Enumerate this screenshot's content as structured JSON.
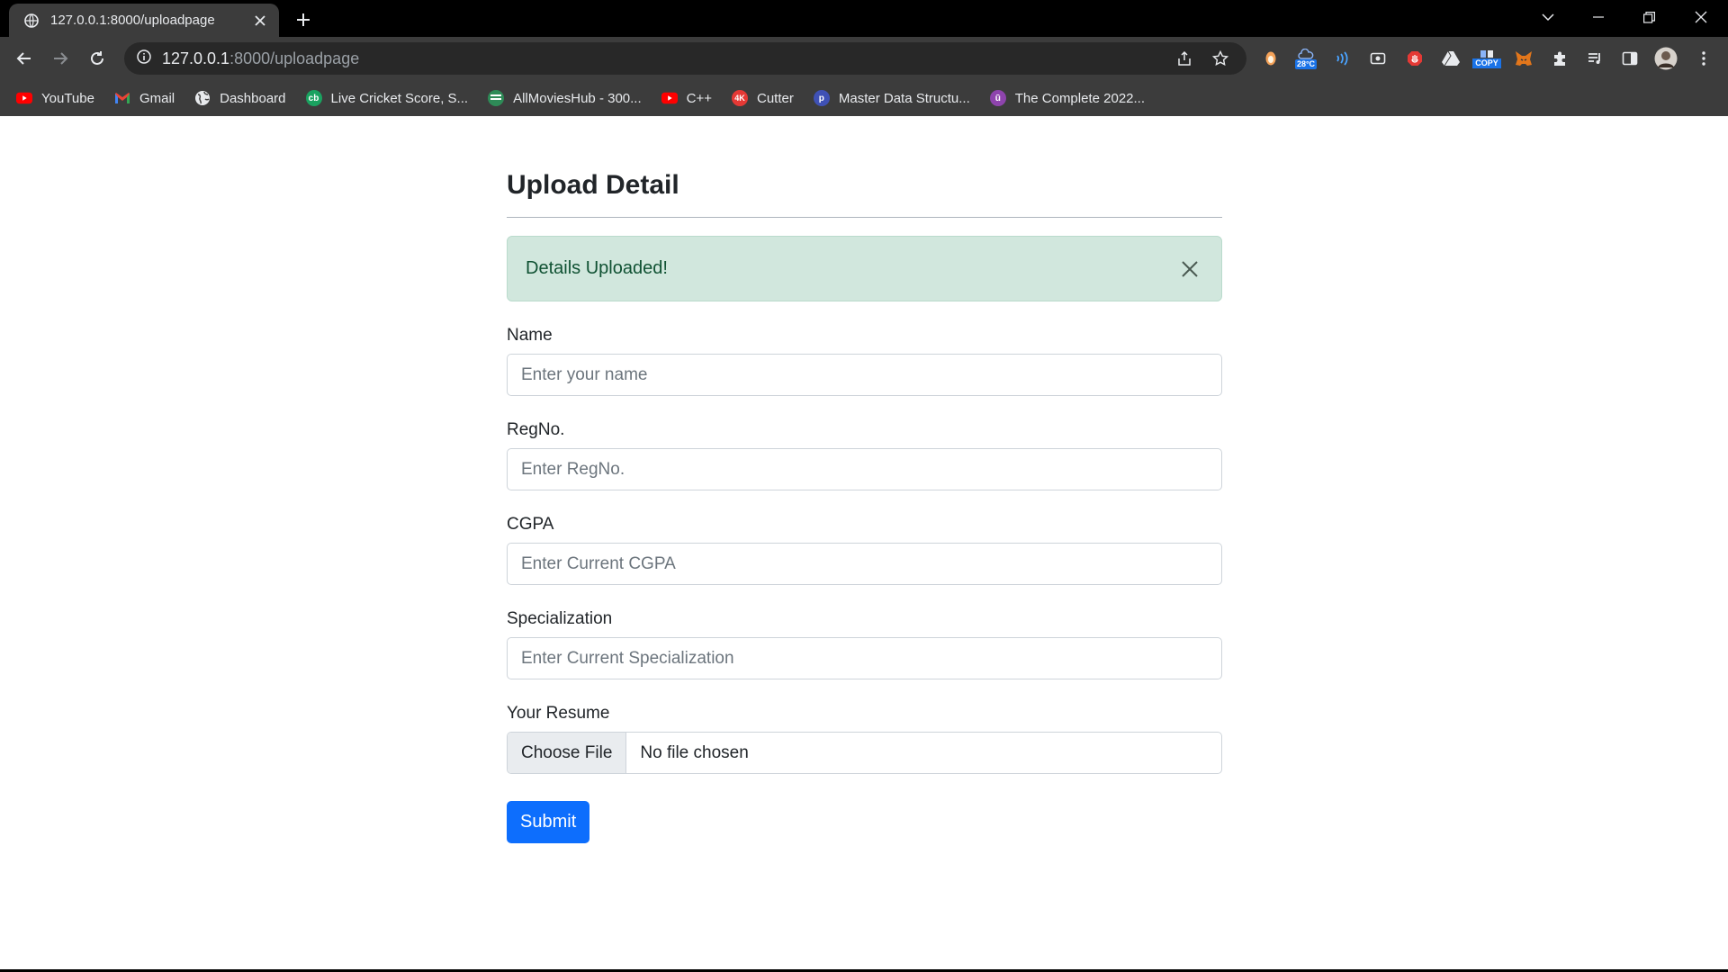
{
  "browser": {
    "tab_title": "127.0.0.1:8000/uploadpage",
    "url_host": "127.0.0.1",
    "url_path": ":8000/uploadpage",
    "weather_temp": "28°C",
    "copy_badge": "COPY"
  },
  "bookmarks": [
    {
      "label": "YouTube",
      "icon": "youtube-icon",
      "color": "#ff0000"
    },
    {
      "label": "Gmail",
      "icon": "gmail-icon",
      "color": "#ea4335"
    },
    {
      "label": "Dashboard",
      "icon": "globe-icon",
      "color": "#9aa0a6"
    },
    {
      "label": "Live Cricket Score, S...",
      "icon": "cricbuzz-icon",
      "color": "#1aa260"
    },
    {
      "label": "AllMoviesHub - 300...",
      "icon": "allmovieshub-icon",
      "color": "#2e8b57"
    },
    {
      "label": "C++",
      "icon": "youtube-icon",
      "color": "#ff0000"
    },
    {
      "label": "Cutter",
      "icon": "4k-icon",
      "color": "#e53935"
    },
    {
      "label": "Master Data Structu...",
      "icon": "pepcoding-icon",
      "color": "#3f51b5"
    },
    {
      "label": "The Complete 2022...",
      "icon": "udemy-icon",
      "color": "#8e44ad"
    }
  ],
  "page": {
    "title": "Upload Detail",
    "alert": "Details Uploaded!",
    "fields": [
      {
        "label": "Name",
        "placeholder": "Enter your name"
      },
      {
        "label": "RegNo.",
        "placeholder": "Enter RegNo."
      },
      {
        "label": "CGPA",
        "placeholder": "Enter Current CGPA"
      },
      {
        "label": "Specialization",
        "placeholder": "Enter Current Specialization"
      }
    ],
    "resume_label": "Your Resume",
    "file_button": "Choose File",
    "file_status": "No file chosen",
    "submit": "Submit"
  },
  "colors": {
    "alert_bg": "#d1e7dd",
    "alert_text": "#0f5132",
    "primary": "#0d6efd"
  }
}
